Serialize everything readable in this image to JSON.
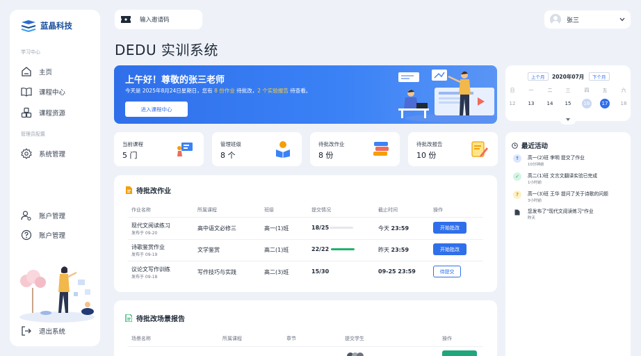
{
  "app": {
    "logo_text": "蓝晶科技",
    "page_title": "DEDU 实训系统"
  },
  "sidebar": {
    "section_learning": "学习中心",
    "items": [
      {
        "label": "主页",
        "icon": "home-icon"
      },
      {
        "label": "课程中心",
        "icon": "book-icon"
      },
      {
        "label": "课程资源",
        "icon": "cubes-icon"
      }
    ],
    "section_admin": "管理员配置",
    "system_label": "系统管理",
    "account_items": [
      {
        "label": "账户管理",
        "icon": "user-gear-icon"
      },
      {
        "label": "账户管理",
        "icon": "question-icon"
      }
    ],
    "logout_label": "退出系统"
  },
  "header": {
    "invite_label": "输入邀请码",
    "user_name": "张三"
  },
  "banner": {
    "greeting": "上午好！尊敬的张三老师",
    "sub_prefix": "今天是 2025年8月24日星期日，您有 ",
    "homework_count": "8 份作业",
    "sub_mid": " 待批改，",
    "report_count": "2 个实验报告",
    "sub_suffix": " 待查看。",
    "button": "进入课程中心"
  },
  "stats": [
    {
      "label": "当前课程",
      "value": "5 门",
      "icon": "presentation-icon"
    },
    {
      "label": "管理班级",
      "value": "8 个",
      "icon": "student-reading-icon"
    },
    {
      "label": "待批改作业",
      "value": "8 份",
      "icon": "stacked-books-icon"
    },
    {
      "label": "待批改报告",
      "value": "10 份",
      "icon": "report-edit-icon"
    }
  ],
  "homework": {
    "title": "待批改作业",
    "headers": [
      "作业名称",
      "所属课程",
      "班级",
      "提交情况",
      "截止时间",
      "操作"
    ],
    "rows": [
      {
        "name": "现代文阅读练习",
        "date": "发布于 09-20",
        "course": "高中语文必修三",
        "class": "高一(1)班",
        "submit": "18/25",
        "progress": 0,
        "deadline_prefix": "今天 ",
        "deadline_time": "23:59",
        "action": "开始批改",
        "style": "primary"
      },
      {
        "name": "诗歌鉴赏作业",
        "date": "发布于 09-19",
        "course": "文学鉴赏",
        "class": "高二(1)班",
        "submit": "22/22",
        "progress": 1,
        "deadline_prefix": "昨天 ",
        "deadline_time": "23:59",
        "action": "开始批改",
        "style": "primary"
      },
      {
        "name": "议论文写作训练",
        "date": "发布于 09-18",
        "course": "写作技巧与实践",
        "class": "高二(3)班",
        "submit": "15/30",
        "progress": 0,
        "deadline_prefix": "",
        "deadline_time": "09-25 23:59",
        "action": "待提交",
        "style": "outline"
      }
    ]
  },
  "reports": {
    "title": "待批改场景报告",
    "headers": [
      "场景名称",
      "所属课程",
      "章节",
      "提交学生",
      "操作"
    ]
  },
  "calendar": {
    "prev": "上个月",
    "title": "2020年07月",
    "next": "下个月",
    "weekdays": [
      "日",
      "一",
      "二",
      "三",
      "四",
      "五",
      "六"
    ],
    "days": [
      "12",
      "13",
      "14",
      "15",
      "16",
      "17",
      "18"
    ],
    "selected_day": "17",
    "highlight_day": "16"
  },
  "activity": {
    "title": "最近活动",
    "items": [
      {
        "text": "高一(2)班 李明 提交了作业",
        "time": "10分钟前",
        "icon": "upload-icon"
      },
      {
        "text": "高二(1)班 文言文翻译实验已完成",
        "time": "1小时前",
        "icon": "check-icon"
      },
      {
        "text": "高一(3)班 王华 提问了关于诗歌的问题",
        "time": "3小时前",
        "icon": "question-icon"
      },
      {
        "text": "您发布了\"现代文阅读练习\"作业",
        "time": "昨天",
        "icon": "document-icon"
      }
    ]
  },
  "colors": {
    "primary": "#2f6fea",
    "success": "#20b26b",
    "highlight": "#ffd43b",
    "brand": "#1a4f9c"
  }
}
